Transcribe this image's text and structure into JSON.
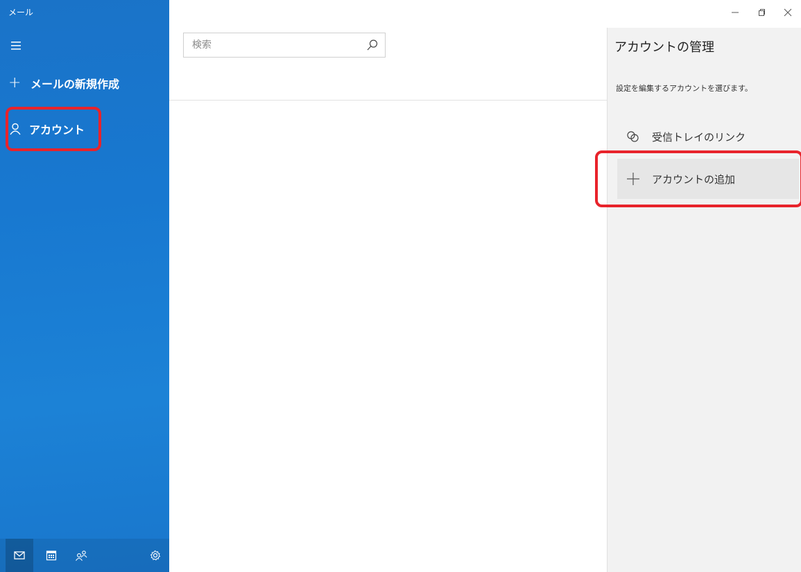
{
  "app": {
    "title": "メール"
  },
  "nav": {
    "compose_label": "メールの新規作成",
    "account_label": "アカウント"
  },
  "search": {
    "placeholder": "検索"
  },
  "manage": {
    "title": "アカウントの管理",
    "subtitle": "設定を編集するアカウントを選びます。",
    "link_inboxes_label": "受信トレイのリンク",
    "add_account_label": "アカウントの追加"
  },
  "icons": {
    "hamburger": "hamburger-icon",
    "compose": "plus-icon",
    "account": "person-icon",
    "search": "search-icon",
    "link": "link-icon",
    "add": "plus-icon",
    "mail": "mail-icon",
    "calendar": "calendar-icon",
    "people": "people-icon",
    "settings": "gear-icon",
    "minimize": "minimize-icon",
    "restore": "restore-icon",
    "close": "close-icon"
  },
  "colors": {
    "nav_background": "#1a73c8",
    "highlight": "#e8232b",
    "panel_background": "#f2f2f2"
  }
}
